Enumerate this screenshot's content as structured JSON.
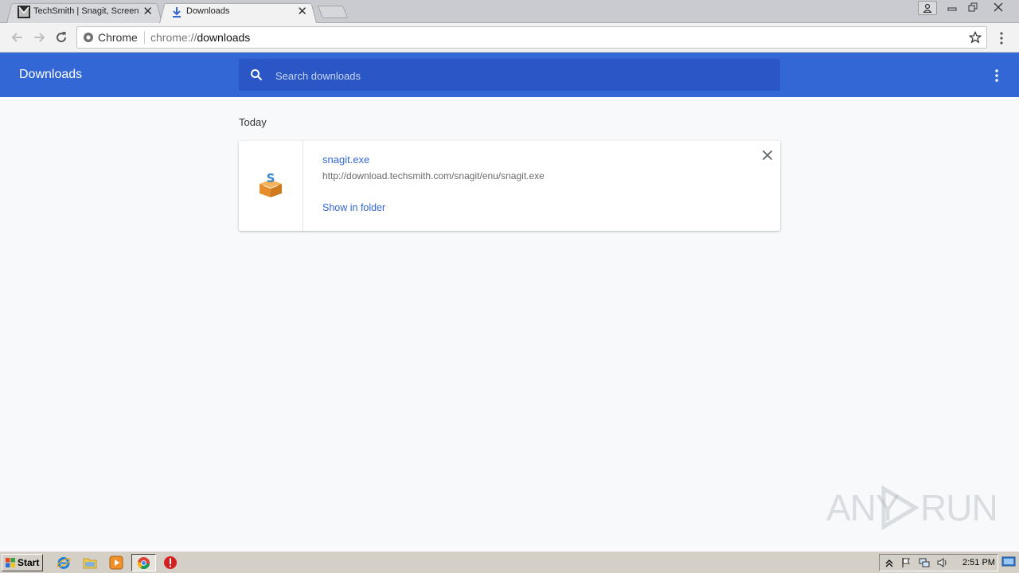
{
  "browser": {
    "tabs": [
      {
        "title": "TechSmith | Snagit, Screen",
        "icon": "techsmith-favicon",
        "active": false
      },
      {
        "title": "Downloads",
        "icon": "download-arrow-icon",
        "active": true
      }
    ],
    "close_glyph": "✕",
    "omnibox": {
      "chip_label": "Chrome",
      "url_scheme": "chrome://",
      "url_path": "downloads"
    }
  },
  "downloads_page": {
    "title": "Downloads",
    "search_placeholder": "Search downloads",
    "section_label": "Today",
    "items": [
      {
        "file_name": "snagit.exe",
        "url": "http://download.techsmith.com/snagit/enu/snagit.exe",
        "action_label": "Show in folder"
      }
    ]
  },
  "taskbar": {
    "start_label": "Start",
    "clock": "2:51 PM"
  },
  "watermark": {
    "left": "ANY",
    "right": "RUN"
  },
  "colors": {
    "header_blue": "#3367d6",
    "search_blue": "#2a56c6",
    "link_blue": "#3367d6",
    "page_background": "#f7f9fb"
  }
}
